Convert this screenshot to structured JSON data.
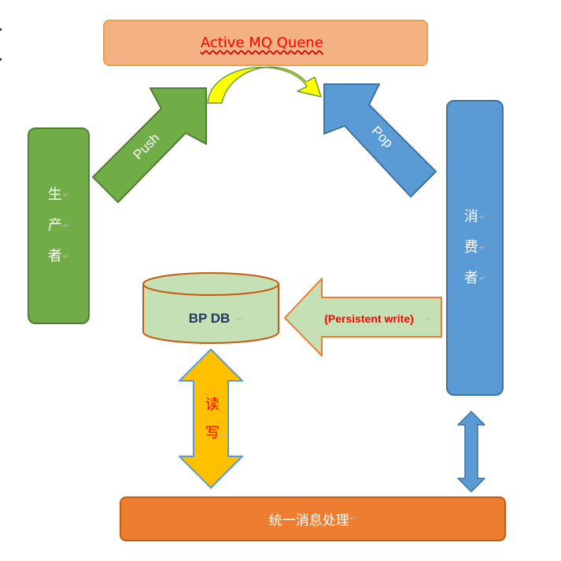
{
  "queue": {
    "label": "Active MQ Quene"
  },
  "producer": {
    "chars": [
      "生",
      "产",
      "者"
    ]
  },
  "consumer": {
    "chars": [
      "消",
      "费",
      "者"
    ]
  },
  "arrows": {
    "push_label": "Push",
    "pop_label": "Pop",
    "persistent_label": "(Persistent write)",
    "readwrite_chars": [
      "读",
      "写"
    ]
  },
  "database": {
    "label": "BP DB"
  },
  "bottom": {
    "label": "统一消息处理"
  },
  "colors": {
    "queue_fill": "#f4b183",
    "producer_fill": "#70ad47",
    "consumer_fill": "#5b9bd5",
    "bottom_fill": "#ed7d31",
    "db_fill": "#c5e0b4",
    "persistent_arrow_fill": "#c5e0b4",
    "readwrite_arrow_fill": "#ffc000",
    "curved_arrow_fill": "#ffff00"
  }
}
